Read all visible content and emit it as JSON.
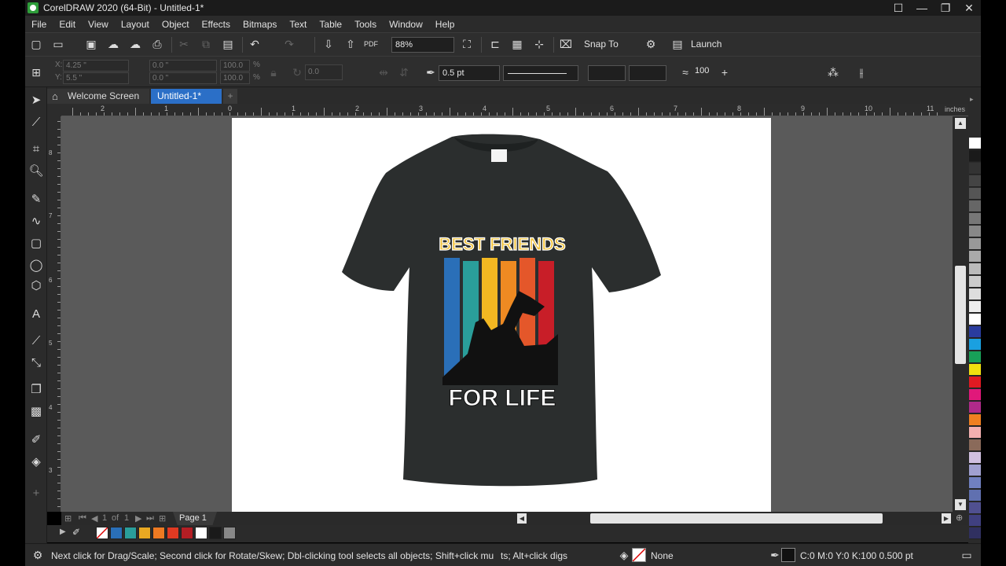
{
  "window": {
    "title": "CorelDRAW 2020 (64-Bit) - Untitled-1*",
    "minimize": "—",
    "maximize": "❐",
    "close": "✕"
  },
  "menu": [
    "File",
    "Edit",
    "View",
    "Layout",
    "Object",
    "Effects",
    "Bitmaps",
    "Text",
    "Table",
    "Tools",
    "Window",
    "Help"
  ],
  "toolbar": {
    "zoom_value": "88%",
    "snap_label": "Snap To",
    "launch_label": "Launch"
  },
  "property_bar": {
    "x": "4.25 \"",
    "y": "5.5 \"",
    "width": "0.0 \"",
    "height": "0.0 \"",
    "scale_w": "100.0",
    "scale_h": "100.0",
    "scale_unit": "%",
    "angle": "0.0",
    "outline_width": "0.5 pt",
    "smoothing": "100"
  },
  "tabs": {
    "welcome": "Welcome Screen",
    "document": "Untitled-1*",
    "add": "+"
  },
  "ruler": {
    "unit": "inches",
    "h_labels": [
      "2",
      "1",
      "0",
      "1",
      "2",
      "3",
      "4",
      "5",
      "6",
      "7",
      "8",
      "9",
      "10",
      "11"
    ],
    "v_labels": [
      "8",
      "7",
      "6",
      "5",
      "4",
      "3"
    ]
  },
  "page_nav": {
    "current": "1",
    "of": "of",
    "total": "1",
    "page_tab": "Page 1"
  },
  "design": {
    "headline": "BEST FRIENDS",
    "tagline": "FOR LIFE",
    "shirt_color": "#2b2e2e",
    "stripe_colors": [
      "#2a6fb8",
      "#2a9e9a",
      "#f2b822",
      "#ee8a22",
      "#e4572a",
      "#c81e28"
    ]
  },
  "bottom_palette": [
    "#2a6fb8",
    "#2a9e9a",
    "#e8a822",
    "#ee7a22",
    "#e03a22",
    "#b41e24",
    "#ffffff",
    "#1a1a1a",
    "#888888"
  ],
  "right_palette": [
    "#ffffff",
    "#1a1a1a",
    "#333333",
    "#444444",
    "#555555",
    "#666666",
    "#777777",
    "#888888",
    "#999999",
    "#aaaaaa",
    "#bbbbbb",
    "#cccccc",
    "#dddddd",
    "#eeeeee",
    "#ffffff",
    "#2a3c9e",
    "#1aa0e0",
    "#18a058",
    "#f0e010",
    "#e01a22",
    "#e0187a",
    "#b02a8a",
    "#f08020",
    "#f4b0b0",
    "#8a6a5a",
    "#d0c0e0",
    "#a0a0d0",
    "#7080c0",
    "#6070b0",
    "#505090",
    "#404080",
    "#303060"
  ],
  "status": {
    "hint": "Next click for Drag/Scale; Second click for Rotate/Skew; Dbl-clicking tool selects all objects; Shift+click mu",
    "hint2": "ts; Alt+click digs",
    "fill": "None",
    "outline": "C:0 M:0 Y:0 K:100  0.500 pt"
  }
}
